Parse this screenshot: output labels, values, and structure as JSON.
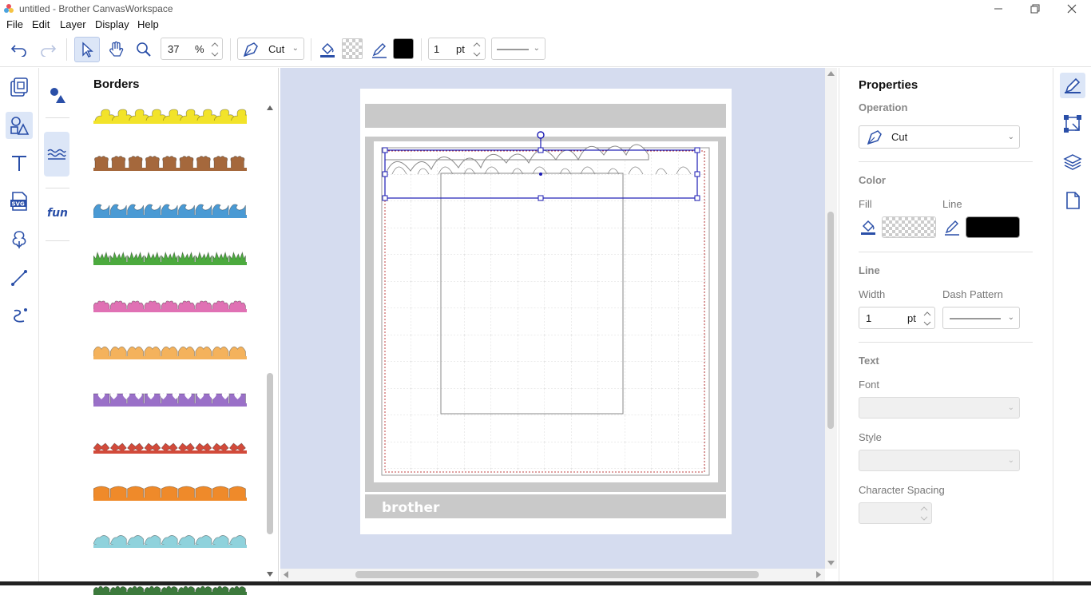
{
  "window": {
    "title": "untitled - Brother CanvasWorkspace",
    "controls": [
      "minimize",
      "restore",
      "close"
    ]
  },
  "menu": [
    "File",
    "Edit",
    "Layer",
    "Display",
    "Help"
  ],
  "toolbar": {
    "zoom_value": "37",
    "zoom_unit": "%",
    "operation": "Cut",
    "line_width": "1",
    "line_unit": "pt",
    "line_color": "#000000"
  },
  "left_tools": [
    "project-icon",
    "shapes-icon",
    "text-icon",
    "svg-icon",
    "tracing-icon",
    "line-draw-icon",
    "freehand-draw-icon"
  ],
  "categories": [
    "basic-shapes-icon",
    "borders-icon",
    "fun-icon"
  ],
  "shapes_panel": {
    "heading": "Borders",
    "items": [
      {
        "name": "ducks",
        "color": "#f2e32a",
        "icon": "duck-border-icon"
      },
      {
        "name": "bears",
        "color": "#a5683c",
        "icon": "bear-border-icon"
      },
      {
        "name": "waves",
        "color": "#4a9ad4",
        "icon": "wave-border-icon"
      },
      {
        "name": "grass",
        "color": "#4caa3e",
        "icon": "grass-border-icon"
      },
      {
        "name": "flowers",
        "color": "#e071b4",
        "icon": "flower-border-icon"
      },
      {
        "name": "lace",
        "color": "#f4b25c",
        "icon": "lace-border-icon"
      },
      {
        "name": "hearts",
        "color": "#9a70c8",
        "icon": "heart-border-icon"
      },
      {
        "name": "bows",
        "color": "#d24a3a",
        "icon": "bow-border-icon"
      },
      {
        "name": "pumpkins",
        "color": "#ef8a2a",
        "icon": "pumpkin-border-icon"
      },
      {
        "name": "ghosts",
        "color": "#8fd2dc",
        "icon": "ghost-border-icon"
      },
      {
        "name": "dinosaurs",
        "color": "#3c7a3c",
        "icon": "dino-border-icon"
      }
    ]
  },
  "canvas": {
    "mat_logo": "brother",
    "selection_color": "#1b1bb3",
    "cut_area_color": "#c04040"
  },
  "properties": {
    "title": "Properties",
    "operation_label": "Operation",
    "operation_value": "Cut",
    "color_label": "Color",
    "fill_label": "Fill",
    "line_label": "Line",
    "line_color": "#000000",
    "line_section": "Line",
    "width_label": "Width",
    "width_value": "1",
    "width_unit": "pt",
    "dash_label": "Dash Pattern",
    "text_section": "Text",
    "font_label": "Font",
    "style_label": "Style",
    "spacing_label": "Character Spacing"
  },
  "right_tools": [
    "properties-icon",
    "transform-icon",
    "layers-icon",
    "page-icon"
  ]
}
